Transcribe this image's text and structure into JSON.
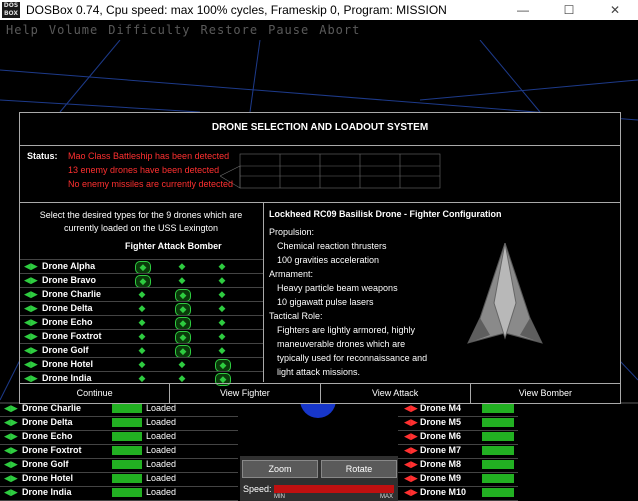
{
  "window": {
    "icon_text": "DOS BOX",
    "title": "DOSBox 0.74, Cpu speed: max 100% cycles, Frameskip  0, Program:  MISSION",
    "minimize": "—",
    "maximize": "☐",
    "close": "✕"
  },
  "menu": [
    "Help",
    "Volume",
    "Difficulty",
    "Restore",
    "Pause",
    "Abort"
  ],
  "dialog": {
    "title": "DRONE SELECTION AND LOADOUT SYSTEM",
    "status_label": "Status:",
    "status_lines": [
      "Mao Class Battleship has been detected",
      "13 enemy drones have been detected",
      "No enemy missiles are currently detected"
    ],
    "instruction": "Select the desired types for the 9 drones which are currently loaded on the USS Lexington",
    "column_header": "Fighter Attack Bomber",
    "drones": [
      {
        "name": "Drone Alpha",
        "selected": "fighter"
      },
      {
        "name": "Drone Bravo",
        "selected": "fighter"
      },
      {
        "name": "Drone Charlie",
        "selected": "attack"
      },
      {
        "name": "Drone Delta",
        "selected": "attack"
      },
      {
        "name": "Drone Echo",
        "selected": "attack"
      },
      {
        "name": "Drone Foxtrot",
        "selected": "attack"
      },
      {
        "name": "Drone Golf",
        "selected": "attack"
      },
      {
        "name": "Drone Hotel",
        "selected": "bomber"
      },
      {
        "name": "Drone India",
        "selected": "bomber"
      }
    ],
    "craft_title": "Lockheed RC09 Basilisk Drone - Fighter Configuration",
    "specs": {
      "propulsion_label": "Propulsion:",
      "propulsion": [
        "Chemical reaction thrusters",
        "100 gravities acceleration"
      ],
      "armament_label": "Armament:",
      "armament": [
        "Heavy particle beam weapons",
        "10 gigawatt pulse lasers"
      ],
      "tactical_label": "Tactical Role:",
      "tactical": [
        "Fighters are lightly armored, highly",
        "maneuverable drones which are",
        "typically used for reconnaissance and",
        "light attack missions."
      ]
    },
    "buttons": [
      "Continue",
      "View Fighter",
      "View Attack",
      "View Bomber"
    ]
  },
  "own_drones": [
    {
      "name": "Drone Charlie",
      "state": "Loaded"
    },
    {
      "name": "Drone Delta",
      "state": "Loaded"
    },
    {
      "name": "Drone Echo",
      "state": "Loaded"
    },
    {
      "name": "Drone Foxtrot",
      "state": "Loaded"
    },
    {
      "name": "Drone Golf",
      "state": "Loaded"
    },
    {
      "name": "Drone Hotel",
      "state": "Loaded"
    },
    {
      "name": "Drone India",
      "state": "Loaded"
    }
  ],
  "enemy_drones": [
    "Drone M4",
    "Drone M5",
    "Drone M6",
    "Drone M7",
    "Drone M8",
    "Drone M9",
    "Drone M10"
  ],
  "controls": {
    "zoom": "Zoom",
    "rotate": "Rotate",
    "speed_label": "Speed:",
    "min": "MIN",
    "max": "MAX"
  },
  "colors": {
    "status_text": "#ff3030",
    "accent_green": "#2ecc40",
    "loaded_bar": "#22b022"
  }
}
